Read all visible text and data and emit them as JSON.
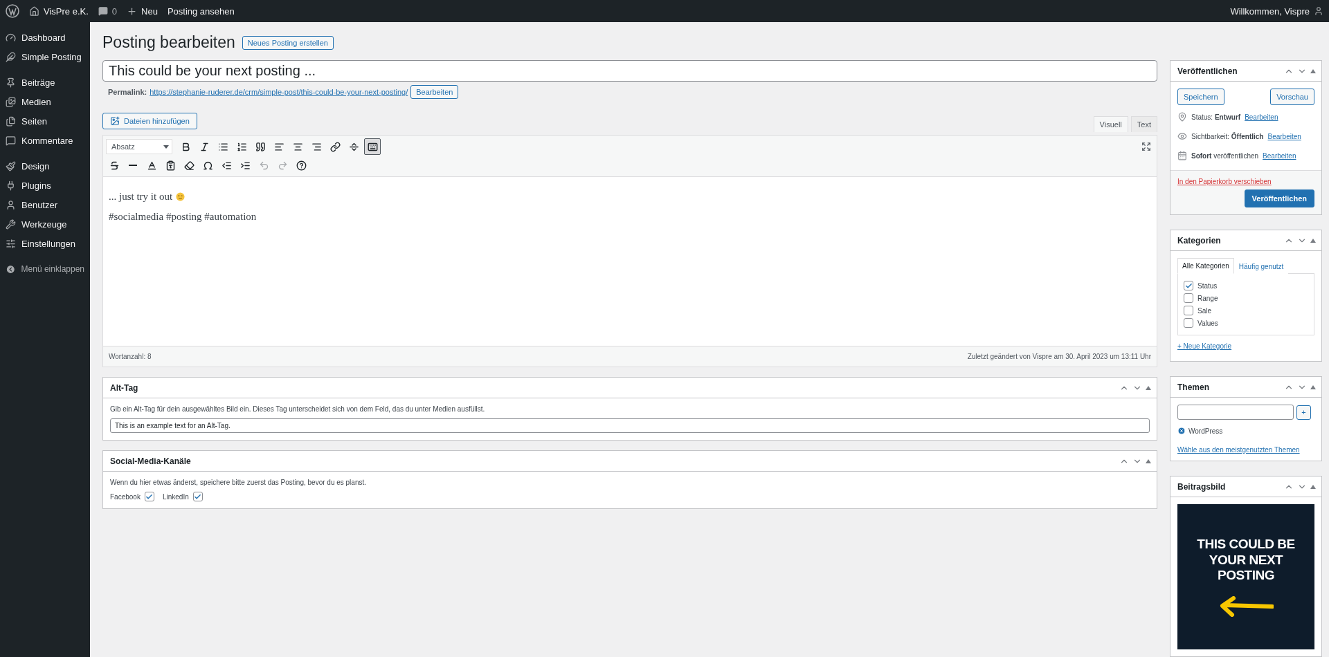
{
  "admin_bar": {
    "site": "VisPre e.K.",
    "comments": "0",
    "new": "Neu",
    "view": "Posting ansehen",
    "greeting": "Willkommen, Vispre"
  },
  "sidebar": {
    "groups": [
      {
        "items": [
          {
            "label": "Dashboard",
            "selected": false
          },
          {
            "label": "Simple Posting",
            "selected": false
          }
        ]
      },
      {
        "items": [
          {
            "label": "Beiträge",
            "selected": false
          },
          {
            "label": "Medien",
            "selected": false
          },
          {
            "label": "Seiten",
            "selected": false
          },
          {
            "label": "Kommentare",
            "selected": false
          }
        ]
      },
      {
        "items": [
          {
            "label": "Design",
            "selected": false
          },
          {
            "label": "Plugins",
            "selected": false
          },
          {
            "label": "Benutzer",
            "selected": false
          },
          {
            "label": "Werkzeuge",
            "selected": false
          },
          {
            "label": "Einstellungen",
            "selected": false
          }
        ]
      }
    ],
    "collapse": "Menü einklappen"
  },
  "page": {
    "title": "Posting bearbeiten",
    "new_button": "Neues Posting erstellen"
  },
  "post": {
    "title": "This could be your next posting ...",
    "permalink_label": "Permalink:",
    "permalink": "https://stephanie-ruderer.de/crm/simple-post/this-could-be-your-next-posting/",
    "permalink_edit": "Bearbeiten"
  },
  "editor": {
    "add_media": "Dateien hinzufügen",
    "tabs": [
      {
        "label": "Visuell",
        "selected": true
      },
      {
        "label": "Text",
        "selected": false
      }
    ],
    "format": "Absatz",
    "toolbar": [
      [
        {
          "kind": "bold",
          "on": false,
          "disabled": false
        },
        {
          "kind": "italic",
          "on": false,
          "disabled": false
        },
        {
          "kind": "bullets",
          "on": false,
          "disabled": false
        },
        {
          "kind": "numbers",
          "on": false,
          "disabled": false
        },
        {
          "kind": "quote",
          "on": false,
          "disabled": false
        },
        {
          "kind": "align-left",
          "on": false,
          "disabled": false
        },
        {
          "kind": "align-center",
          "on": false,
          "disabled": false
        },
        {
          "kind": "align-right",
          "on": false,
          "disabled": false
        },
        {
          "kind": "link",
          "on": false,
          "disabled": false
        },
        {
          "kind": "more",
          "on": false,
          "disabled": false
        },
        {
          "kind": "toolbar",
          "on": true,
          "disabled": false
        }
      ],
      [
        {
          "kind": "strike",
          "on": false,
          "disabled": false
        },
        {
          "kind": "hr",
          "on": false,
          "disabled": false
        },
        {
          "kind": "color",
          "on": false,
          "disabled": false
        },
        {
          "kind": "paste",
          "on": false,
          "disabled": false
        },
        {
          "kind": "clear",
          "on": false,
          "disabled": false
        },
        {
          "kind": "char",
          "on": false,
          "disabled": false
        },
        {
          "kind": "outdent",
          "on": false,
          "disabled": false
        },
        {
          "kind": "indent",
          "on": false,
          "disabled": false
        },
        {
          "kind": "undo",
          "on": false,
          "disabled": true
        },
        {
          "kind": "redo",
          "on": false,
          "disabled": true
        },
        {
          "kind": "help",
          "on": false,
          "disabled": false
        }
      ]
    ],
    "paragraphs": [
      {
        "text": "... just try it out",
        "emoji": true
      },
      {
        "text": "#socialmedia #posting #automation",
        "emoji": false
      }
    ],
    "word_count": "Wortanzahl: 8",
    "last_edited": "Zuletzt geändert von Vispre am 30. April 2023 um 13:11 Uhr"
  },
  "alt_tag": {
    "title": "Alt-Tag",
    "description": "Gib ein Alt-Tag für dein ausgewähltes Bild ein. Dieses Tag unterscheidet sich von dem Feld, das du unter Medien ausfüllst.",
    "value": "This is an example text for an Alt-Tag."
  },
  "social": {
    "title": "Social-Media-Kanäle",
    "description": "Wenn du hier etwas änderst, speichere bitte zuerst das Posting, bevor du es planst.",
    "channels": [
      {
        "label": "Facebook",
        "checked": true
      },
      {
        "label": "LinkedIn",
        "checked": true
      }
    ]
  },
  "publish": {
    "title": "Veröffentlichen",
    "save": "Speichern",
    "preview": "Vorschau",
    "meta": [
      {
        "text": "Status: **Entwurf**",
        "link": "Bearbeiten"
      },
      {
        "text": "Sichtbarkeit: **Öffentlich**",
        "link": "Bearbeiten"
      },
      {
        "text": "**Sofort** veröffentlichen",
        "link": "Bearbeiten"
      }
    ],
    "trash": "In den Papierkorb verschieben",
    "publish": "Veröffentlichen"
  },
  "categories": {
    "title": "Kategorien",
    "tabs": [
      {
        "label": "Alle Kategorien",
        "selected": true
      },
      {
        "label": "Häufig genutzt",
        "selected": false
      }
    ],
    "items": [
      {
        "label": "Status",
        "checked": true
      },
      {
        "label": "Range",
        "checked": false
      },
      {
        "label": "Sale",
        "checked": false
      },
      {
        "label": "Values",
        "checked": false
      }
    ],
    "add": "+ Neue Kategorie"
  },
  "tags": {
    "title": "Themen",
    "add": "+",
    "items": [
      "WordPress"
    ],
    "choose": "Wähle aus den meistgenutzten Themen"
  },
  "featured": {
    "title": "Beitragsbild",
    "image_text": "THIS COULD BE YOUR NEXT POSTING"
  }
}
